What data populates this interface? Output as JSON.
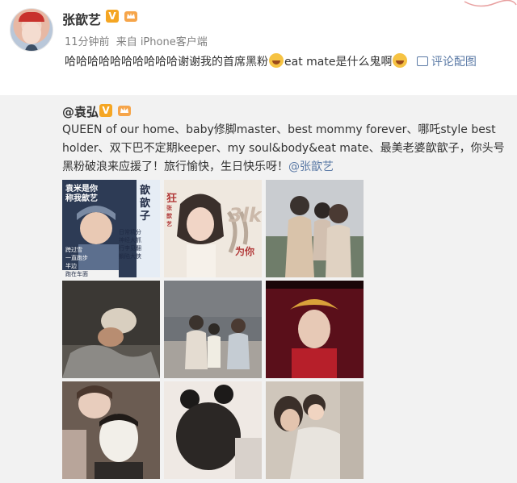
{
  "post": {
    "username": "张歆艺",
    "verified_badge": "V",
    "time": "11分钟前",
    "source": "来自 iPhone客户端",
    "text_part1": "哈哈哈哈哈哈哈哈哈哈谢谢我的首席黑粉",
    "text_part2": "eat mate是什么鬼啊",
    "comment_label": "评论配图",
    "icons": [
      "avatar",
      "vip-crown-icon",
      "laugh-cry-icon",
      "comment-image-icon"
    ]
  },
  "repost": {
    "author": "@袁弘",
    "verified_badge": "V",
    "text": "QUEEN of our home、baby修脚master、best  mommy forever、哪吒style best holder、双下巴不定期keeper、my soul&body&eat mate、最美老婆歆歆子，你头号黑粉破浪来应援了！旅行愉快，生日快乐呀！",
    "mention": "@张歆艺"
  },
  "images": {
    "img1_text_a": "袁米是你",
    "img1_text_b": "称我歆艺",
    "img1_text_c": "歆",
    "img1_text_d": "歆",
    "img1_text_e": "子",
    "img1_text_f": "日常精分",
    "img1_text_g": "神经大抓",
    "img1_text_h": "行李见翻",
    "img1_text_i": "躺陷大侠",
    "img1_text_j": "跨过雪",
    "img1_text_k": "一直跑步",
    "img1_text_l": "半边",
    "img1_text_m": "跑在车面",
    "img2_text_a": "狂",
    "img2_text_b": "张歆艺",
    "img2_text_c": "为你",
    "img2_text_d": "3lk"
  }
}
